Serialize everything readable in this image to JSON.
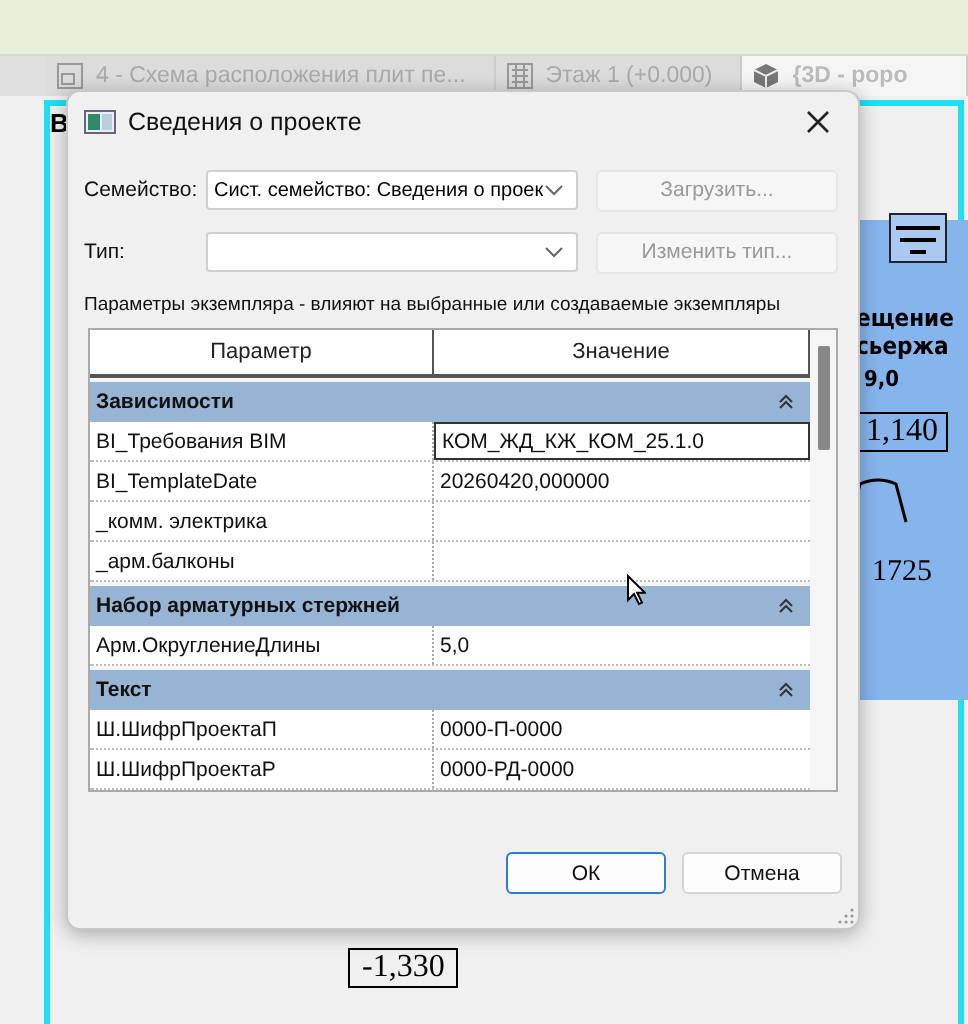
{
  "view_tabs": [
    {
      "label": "4 - Схема расположения плит пе...",
      "selected": false
    },
    {
      "label": "Этаж 1 (+0.000)",
      "selected": false
    },
    {
      "label": "{3D - popo",
      "selected": true
    }
  ],
  "drawing_texts": {
    "left_mark": "В",
    "title_1": "ещение",
    "title_2": "сьержа",
    "value_1": "9,0",
    "elevation_1": "1,140",
    "dimension": "1725",
    "elevation_2": "-1,330"
  },
  "dialog": {
    "title": "Сведения о проекте",
    "family": {
      "label": "Семейство:",
      "value": "Сист. семейство: Сведения о проек",
      "button": "Загрузить...",
      "button_disabled": true
    },
    "type": {
      "label": "Тип:",
      "button": "Изменить тип...",
      "button_disabled": true
    },
    "instance_caption": "Параметры экземпляра - влияют на выбранные или создаваемые экземпляры",
    "table": {
      "columns": [
        "Параметр",
        "Значение"
      ],
      "rows": [
        {
          "kind": "group",
          "label": "Зависимости",
          "expanded": true
        },
        {
          "kind": "param",
          "name": "BI_Требования BIM",
          "value": "КОМ_ЖД_КЖ_КОМ_25.1.0",
          "selected": true
        },
        {
          "kind": "param",
          "name": "BI_TemplateDate",
          "value": "20260420,000000",
          "selected": false
        },
        {
          "kind": "param",
          "name": "_комм. электрика",
          "selected": false
        },
        {
          "kind": "param",
          "name": "_арм.балконы",
          "selected": false
        },
        {
          "kind": "group",
          "label": "Набор арматурных стержней",
          "expanded": true
        },
        {
          "kind": "param",
          "name": "Арм.ОкруглениеДлины",
          "value": "5,0",
          "selected": false
        },
        {
          "kind": "group",
          "label": "Текст",
          "expanded": true
        },
        {
          "kind": "param",
          "name": "Ш.ШифрПроектаП",
          "value": "0000-П-0000",
          "selected": false
        },
        {
          "kind": "param",
          "name": "Ш.ШифрПроектаР",
          "value": "0000-РД-0000",
          "selected": false
        }
      ]
    },
    "buttons": [
      {
        "label": "ОК",
        "default": true
      },
      {
        "label": "Отмена",
        "default": false
      }
    ]
  }
}
